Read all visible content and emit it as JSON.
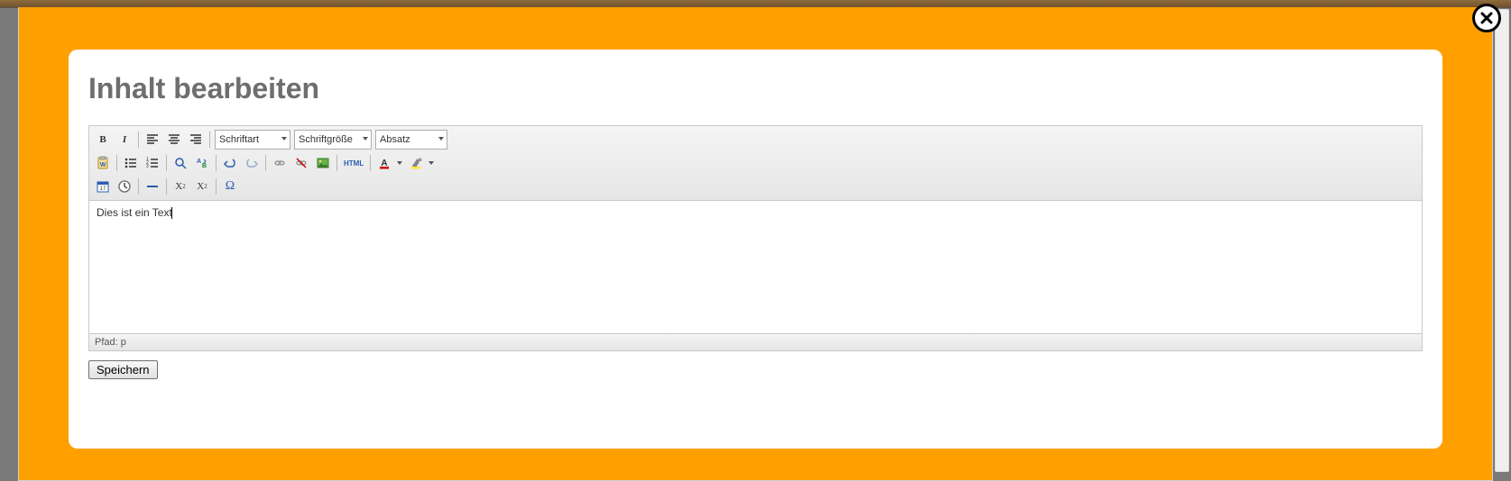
{
  "heading": "Inhalt bearbeiten",
  "toolbar": {
    "font_family_placeholder": "Schriftart",
    "font_size_placeholder": "Schriftgröße",
    "format_placeholder": "Absatz",
    "html_label": "HTML"
  },
  "content": "Dies ist ein Text",
  "statusbar": "Pfad: p",
  "save_label": "Speichern"
}
